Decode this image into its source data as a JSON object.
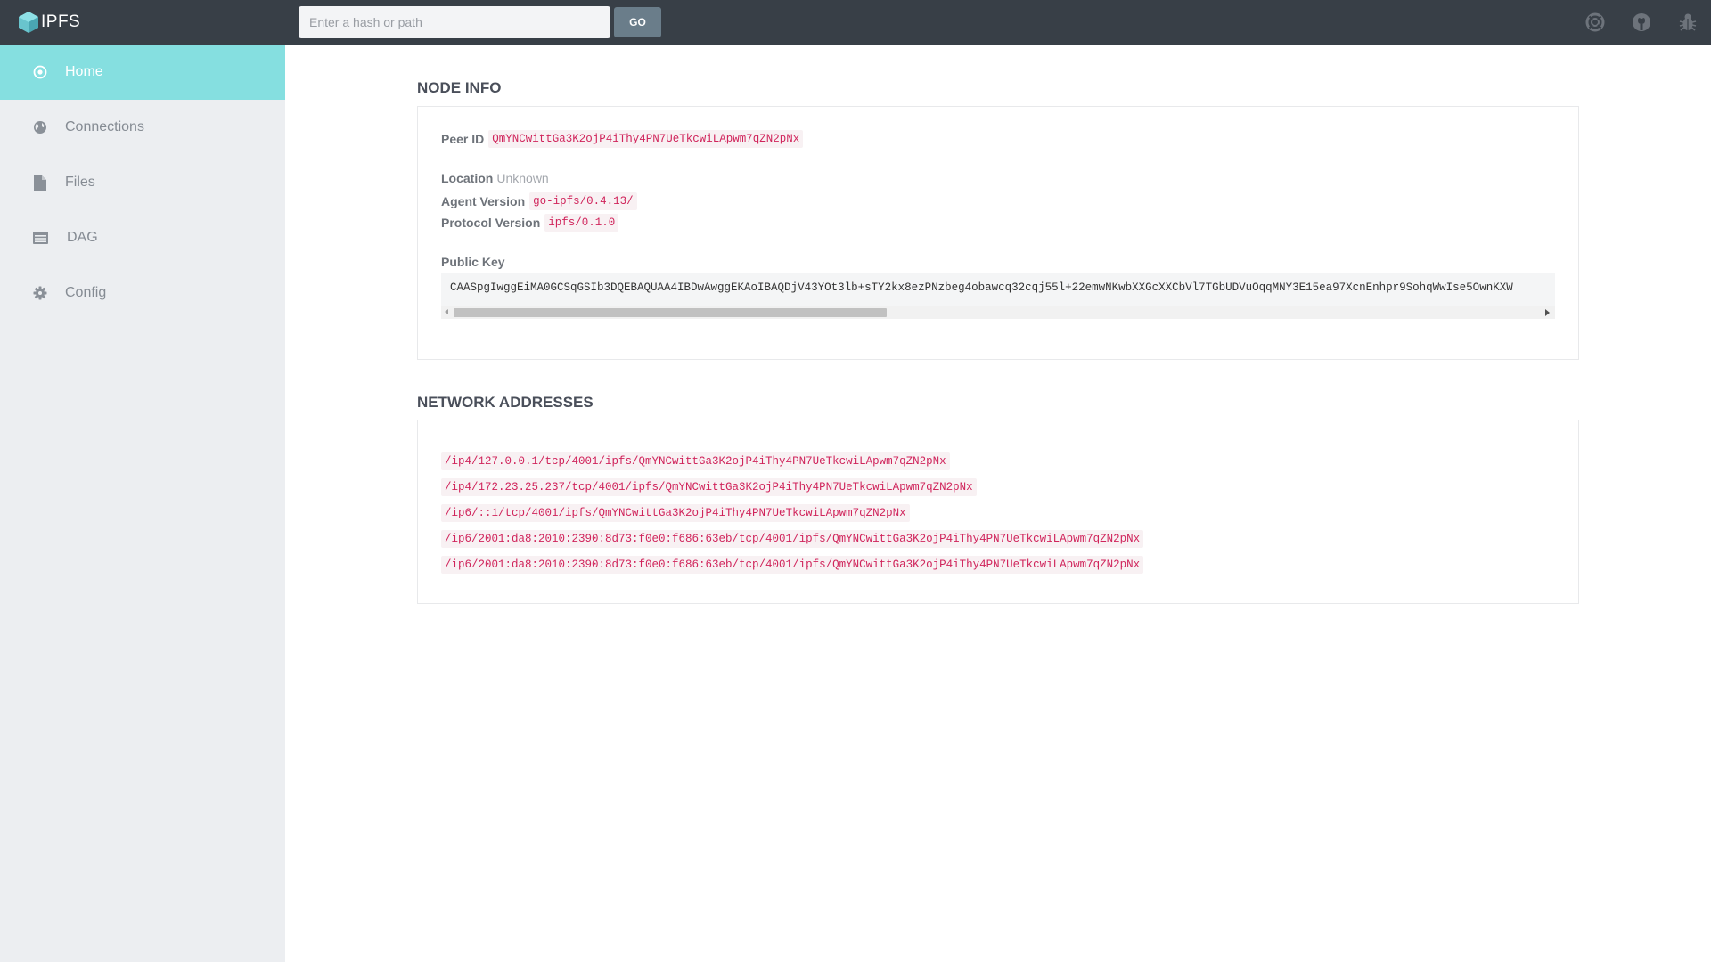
{
  "app": {
    "name": "IPFS"
  },
  "search": {
    "placeholder": "Enter a hash or path",
    "go_label": "GO"
  },
  "top_icons": [
    "support-icon",
    "github-icon",
    "bug-icon"
  ],
  "sidebar": {
    "items": [
      {
        "label": "Home",
        "icon": "home-icon",
        "active": true
      },
      {
        "label": "Connections",
        "icon": "globe-icon",
        "active": false
      },
      {
        "label": "Files",
        "icon": "file-icon",
        "active": false
      },
      {
        "label": "DAG",
        "icon": "dag-icon",
        "active": false
      },
      {
        "label": "Config",
        "icon": "gear-icon",
        "active": false
      }
    ]
  },
  "node_info": {
    "title": "NODE INFO",
    "peer_id_label": "Peer ID",
    "peer_id": "QmYNCwittGa3K2ojP4iThy4PN7UeTkcwiLApwm7qZN2pNx",
    "location_label": "Location",
    "location": "Unknown",
    "agent_version_label": "Agent Version",
    "agent_version": "go-ipfs/0.4.13/",
    "protocol_version_label": "Protocol Version",
    "protocol_version": "ipfs/0.1.0",
    "public_key_label": "Public Key",
    "public_key": "CAASpgIwggEiMA0GCSqGSIb3DQEBAQUAA4IBDwAwggEKAoIBAQDjV43YOt3lb+sTY2kx8ezPNzbeg4obawcq32cqj55l+22emwNKwbXXGcXXCbVl7TGbUDVuOqqMNY3E15ea97XcnEnhpr9SohqWwIse5OwnKXW"
  },
  "network": {
    "title": "NETWORK ADDRESSES",
    "addresses": [
      "/ip4/127.0.0.1/tcp/4001/ipfs/QmYNCwittGa3K2ojP4iThy4PN7UeTkcwiLApwm7qZN2pNx",
      "/ip4/172.23.25.237/tcp/4001/ipfs/QmYNCwittGa3K2ojP4iThy4PN7UeTkcwiLApwm7qZN2pNx",
      "/ip6/::1/tcp/4001/ipfs/QmYNCwittGa3K2ojP4iThy4PN7UeTkcwiLApwm7qZN2pNx",
      "/ip6/2001:da8:2010:2390:8d73:f0e0:f686:63eb/tcp/4001/ipfs/QmYNCwittGa3K2ojP4iThy4PN7UeTkcwiLApwm7qZN2pNx",
      "/ip6/2001:da8:2010:2390:8d73:f0e0:f686:63eb/tcp/4001/ipfs/QmYNCwittGa3K2ojP4iThy4PN7UeTkcwiLApwm7qZN2pNx"
    ]
  },
  "colors": {
    "topbar": "#383f47",
    "sidebar": "#eceef1",
    "active_nav": "#85dfe0",
    "code_text": "#d0245b",
    "logo_teal": "#69c4cd"
  }
}
